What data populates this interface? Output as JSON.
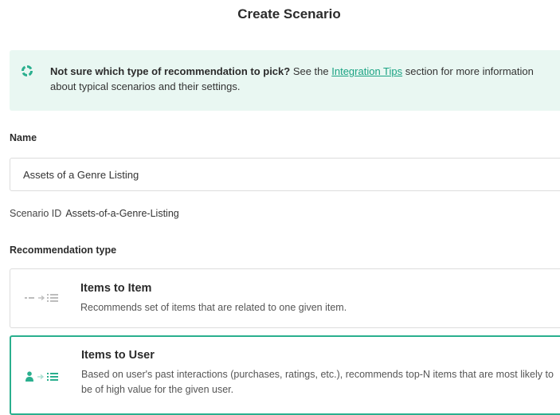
{
  "header": {
    "title": "Create Scenario"
  },
  "info": {
    "bold_text": "Not sure which type of recommendation to pick?",
    "text_before_link": " See the ",
    "link_text": "Integration Tips",
    "text_after_link": " section for more information about typical scenarios and their settings.",
    "icon": "loader-ring-icon",
    "accent_color": "#2aaf8e"
  },
  "form": {
    "name_label": "Name",
    "name_value": "Assets of a Genre Listing",
    "scenario_id_label": "Scenario ID",
    "scenario_id_value": "Assets-of-a-Genre-Listing",
    "recommendation_type_label": "Recommendation type"
  },
  "recommendation_types": [
    {
      "title": "Items to Item",
      "description": "Recommends set of items that are related to one given item.",
      "icon": "item-to-list-icon",
      "selected": false
    },
    {
      "title": "Items to User",
      "description": "Based on user's past interactions (purchases, ratings, etc.), recommends top-N items that are most likely to be of high value for the given user.",
      "icon": "user-to-list-icon",
      "selected": true
    }
  ]
}
